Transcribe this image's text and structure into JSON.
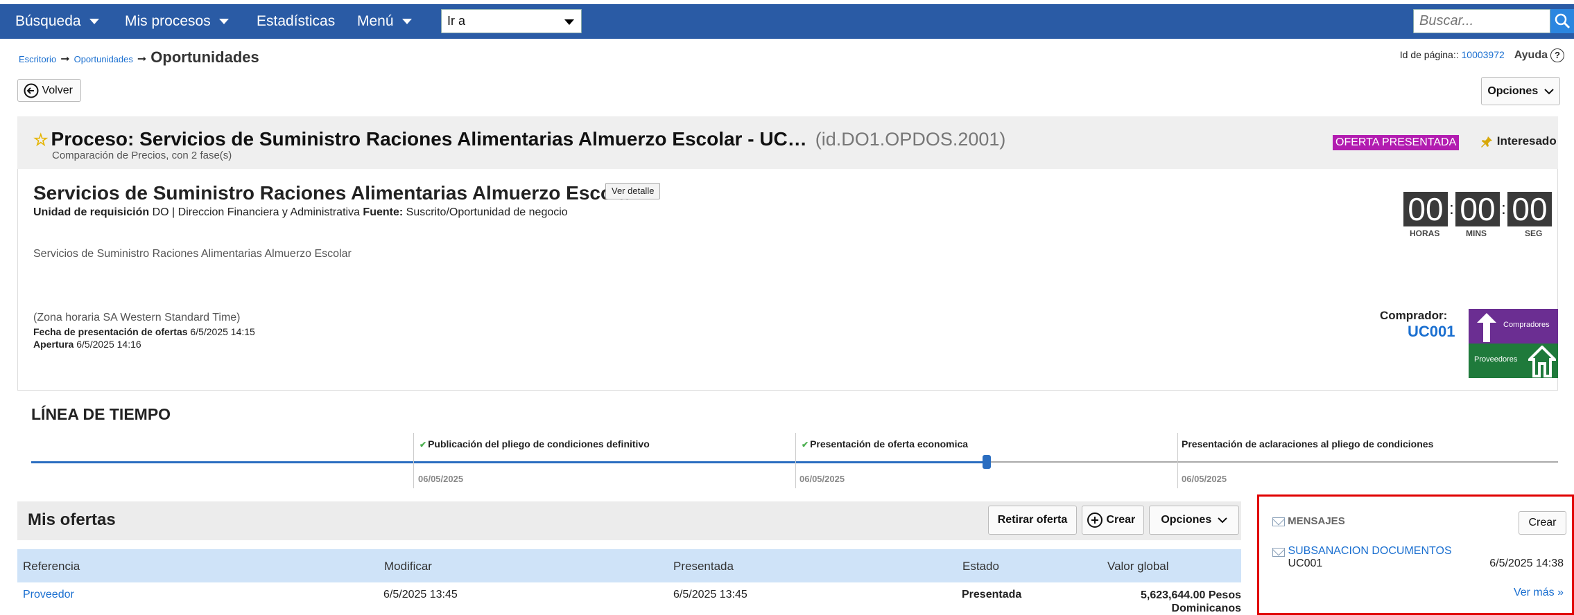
{
  "topnav": {
    "items": [
      "Búsqueda",
      "Mis procesos",
      "Estadísticas",
      "Menú"
    ],
    "goto_label": "Ir a",
    "search_placeholder": "Buscar..."
  },
  "breadcrumb": {
    "items": [
      "Escritorio",
      "Oportunidades"
    ],
    "current": "Oportunidades"
  },
  "page_id": {
    "label": "Id de página::",
    "value": "10003972",
    "help": "Ayuda",
    "help_glyph": "?"
  },
  "back_label": "Volver",
  "options_label": "Opciones",
  "process": {
    "title": "Proceso: Servicios de Suministro Raciones Alimentarias Almuerzo Escolar - UC…",
    "id": "(id.DO1.OPDOS.2001)",
    "subtitle": "Comparación de Precios, con 2 fase(s)",
    "badge": "OFERTA PRESENTADA",
    "badge_color": "#b21cb0",
    "interest_label": "Interesado"
  },
  "detail": {
    "heading": "Servicios de Suministro Raciones Alimentarias Almuerzo Escolar",
    "view_detail": "Ver detalle",
    "unit_label": "Unidad de requisición",
    "unit_value": "DO | Direccion Financiera y Administrativa",
    "source_label": "Fuente:",
    "source_value": "Suscrito/Oportunidad de negocio",
    "description": "Servicios de Suministro Raciones Alimentarias Almuerzo Escolar",
    "timezone": "(Zona horaria SA Western Standard Time)",
    "submission_label": "Fecha de presentación de ofertas",
    "submission_value": "6/5/2025 14:15",
    "opening_label": "Apertura",
    "opening_value": "6/5/2025 14:16"
  },
  "countdown": {
    "hours": "00",
    "mins": "00",
    "secs": "00",
    "hours_label": "HORAS",
    "mins_label": "MINS",
    "secs_label": "SEG"
  },
  "buyer": {
    "label": "Comprador:",
    "id": "UC001",
    "logo_top": "Compradores",
    "logo_bottom": "Proveedores"
  },
  "timeline": {
    "title": "LÍNEA DE TIEMPO",
    "steps": [
      {
        "label": "Publicación del pliego de condiciones definitivo",
        "date": "06/05/2025"
      },
      {
        "label": "Presentación de oferta economica",
        "date": "06/05/2025"
      },
      {
        "label": "Presentación de aclaraciones al pliego de condiciones",
        "date": "06/05/2025"
      }
    ]
  },
  "offers": {
    "title": "Mis ofertas",
    "withdraw": "Retirar oferta",
    "create": "Crear",
    "options": "Opciones",
    "columns": [
      "Referencia",
      "Modificar",
      "Presentada",
      "Estado",
      "Valor global"
    ],
    "row": {
      "reference": "Proveedor",
      "modified": "6/5/2025 13:45",
      "submitted": "6/5/2025 13:45",
      "status": "Presentada",
      "value_line1": "5,623,644.00 Pesos",
      "value_line2": "Dominicanos"
    }
  },
  "messages": {
    "title": "MENSAJES",
    "create": "Crear",
    "item_subject": "SUBSANACION DOCUMENTOS",
    "item_sender": "UC001",
    "item_date": "6/5/2025 14:38",
    "more": "Ver más »"
  }
}
